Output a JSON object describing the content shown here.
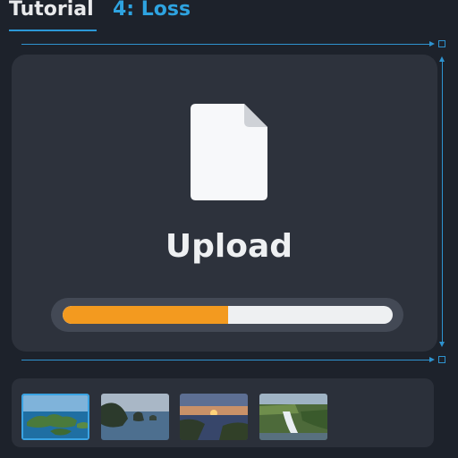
{
  "tabs": [
    {
      "label": "Tutorial"
    },
    {
      "label": "4: Loss"
    }
  ],
  "upload": {
    "label": "Upload",
    "progress": 0.5
  },
  "thumbnails": [
    {
      "name": "coastal-islands",
      "selected": true
    },
    {
      "name": "rock-island-sea",
      "selected": false
    },
    {
      "name": "sunset-bay",
      "selected": false
    },
    {
      "name": "waterfall-cliff",
      "selected": false
    }
  ],
  "colors": {
    "accent": "#2ea3e0",
    "progress_fill": "#f39a1f",
    "background": "#1d222b",
    "card": "#2d323c"
  },
  "icons": [
    "file-icon",
    "resize-handle-icon",
    "arrow-right-icon",
    "arrow-vertical-icon"
  ]
}
